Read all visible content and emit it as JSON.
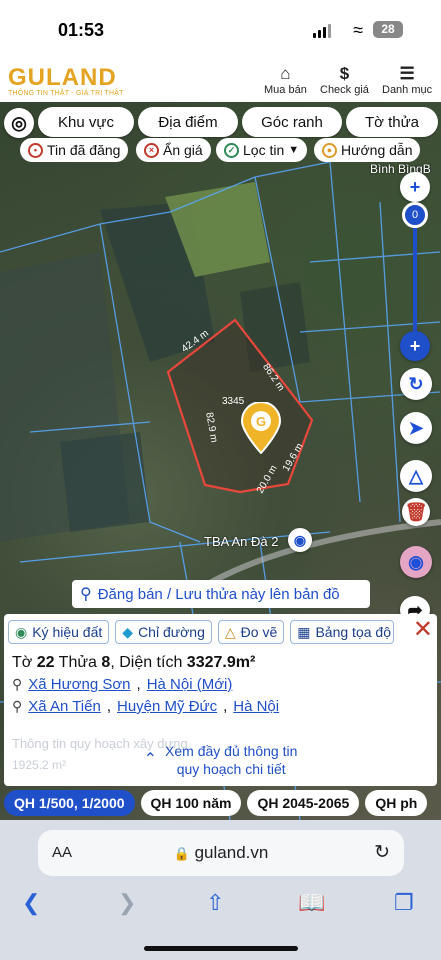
{
  "status": {
    "time": "01:53",
    "battery": "28"
  },
  "header": {
    "logo": "GULAND",
    "logo_sub": "THÔNG TIN THẬT - GIÁ TRỊ THẬT",
    "nav": [
      {
        "label": "Mua bán",
        "icon": "house-icon"
      },
      {
        "label": "Check giá",
        "icon": "dollar-icon"
      },
      {
        "label": "Danh mục",
        "icon": "menu-icon"
      }
    ]
  },
  "filters": [
    "Khu vực",
    "Địa điểm",
    "Góc ranh",
    "Tờ thửa"
  ],
  "chips": [
    {
      "label": "Tin đã đăng",
      "color": "#c0392b"
    },
    {
      "label": "Ẩn giá",
      "color": "#c0392b"
    },
    {
      "label": "Lọc tin",
      "color": "#2e8b57"
    },
    {
      "label": "Hướng dẫn",
      "color": "#e09a2c"
    }
  ],
  "map": {
    "zoom_value": "0",
    "place_label_1": "Bình BìngB",
    "place_label_2": "TBA An Đà 2",
    "dims": {
      "top": "42.4 m",
      "right": "86.2 m",
      "left": "82.9 m",
      "bottom_a": "20.0 m",
      "bottom_b": "19.6 m",
      "inner": "3345"
    },
    "post_label": "Đăng bán / Lưu thửa này lên bản đồ"
  },
  "panel": {
    "tabs": [
      "Ký hiệu đất",
      "Chỉ đường",
      "Đo vẽ",
      "Bảng tọa độ"
    ],
    "to_label": "Tờ",
    "to_value": "22",
    "thua_label": "Thửa",
    "thua_value": "8",
    "area_label": "Diện tích",
    "area_value": "3327.9m²",
    "loc1": [
      "Xã Hương Sơn",
      "Hà Nội (Mới)"
    ],
    "loc2": [
      "Xã An Tiến",
      "Huyện Mỹ Đức",
      "Hà Nội"
    ],
    "faded": "Thông tin quy hoạch xây dựng",
    "faded_value": "1925.2 m²",
    "more_line1": "Xem đầy đủ thông tin",
    "more_line2": "quy hoạch chi tiết"
  },
  "qh": [
    "QH 1/500, 1/2000",
    "QH 100 năm",
    "QH 2045-2065",
    "QH ph"
  ],
  "browser": {
    "aa": "AA",
    "url": "guland.vn"
  }
}
